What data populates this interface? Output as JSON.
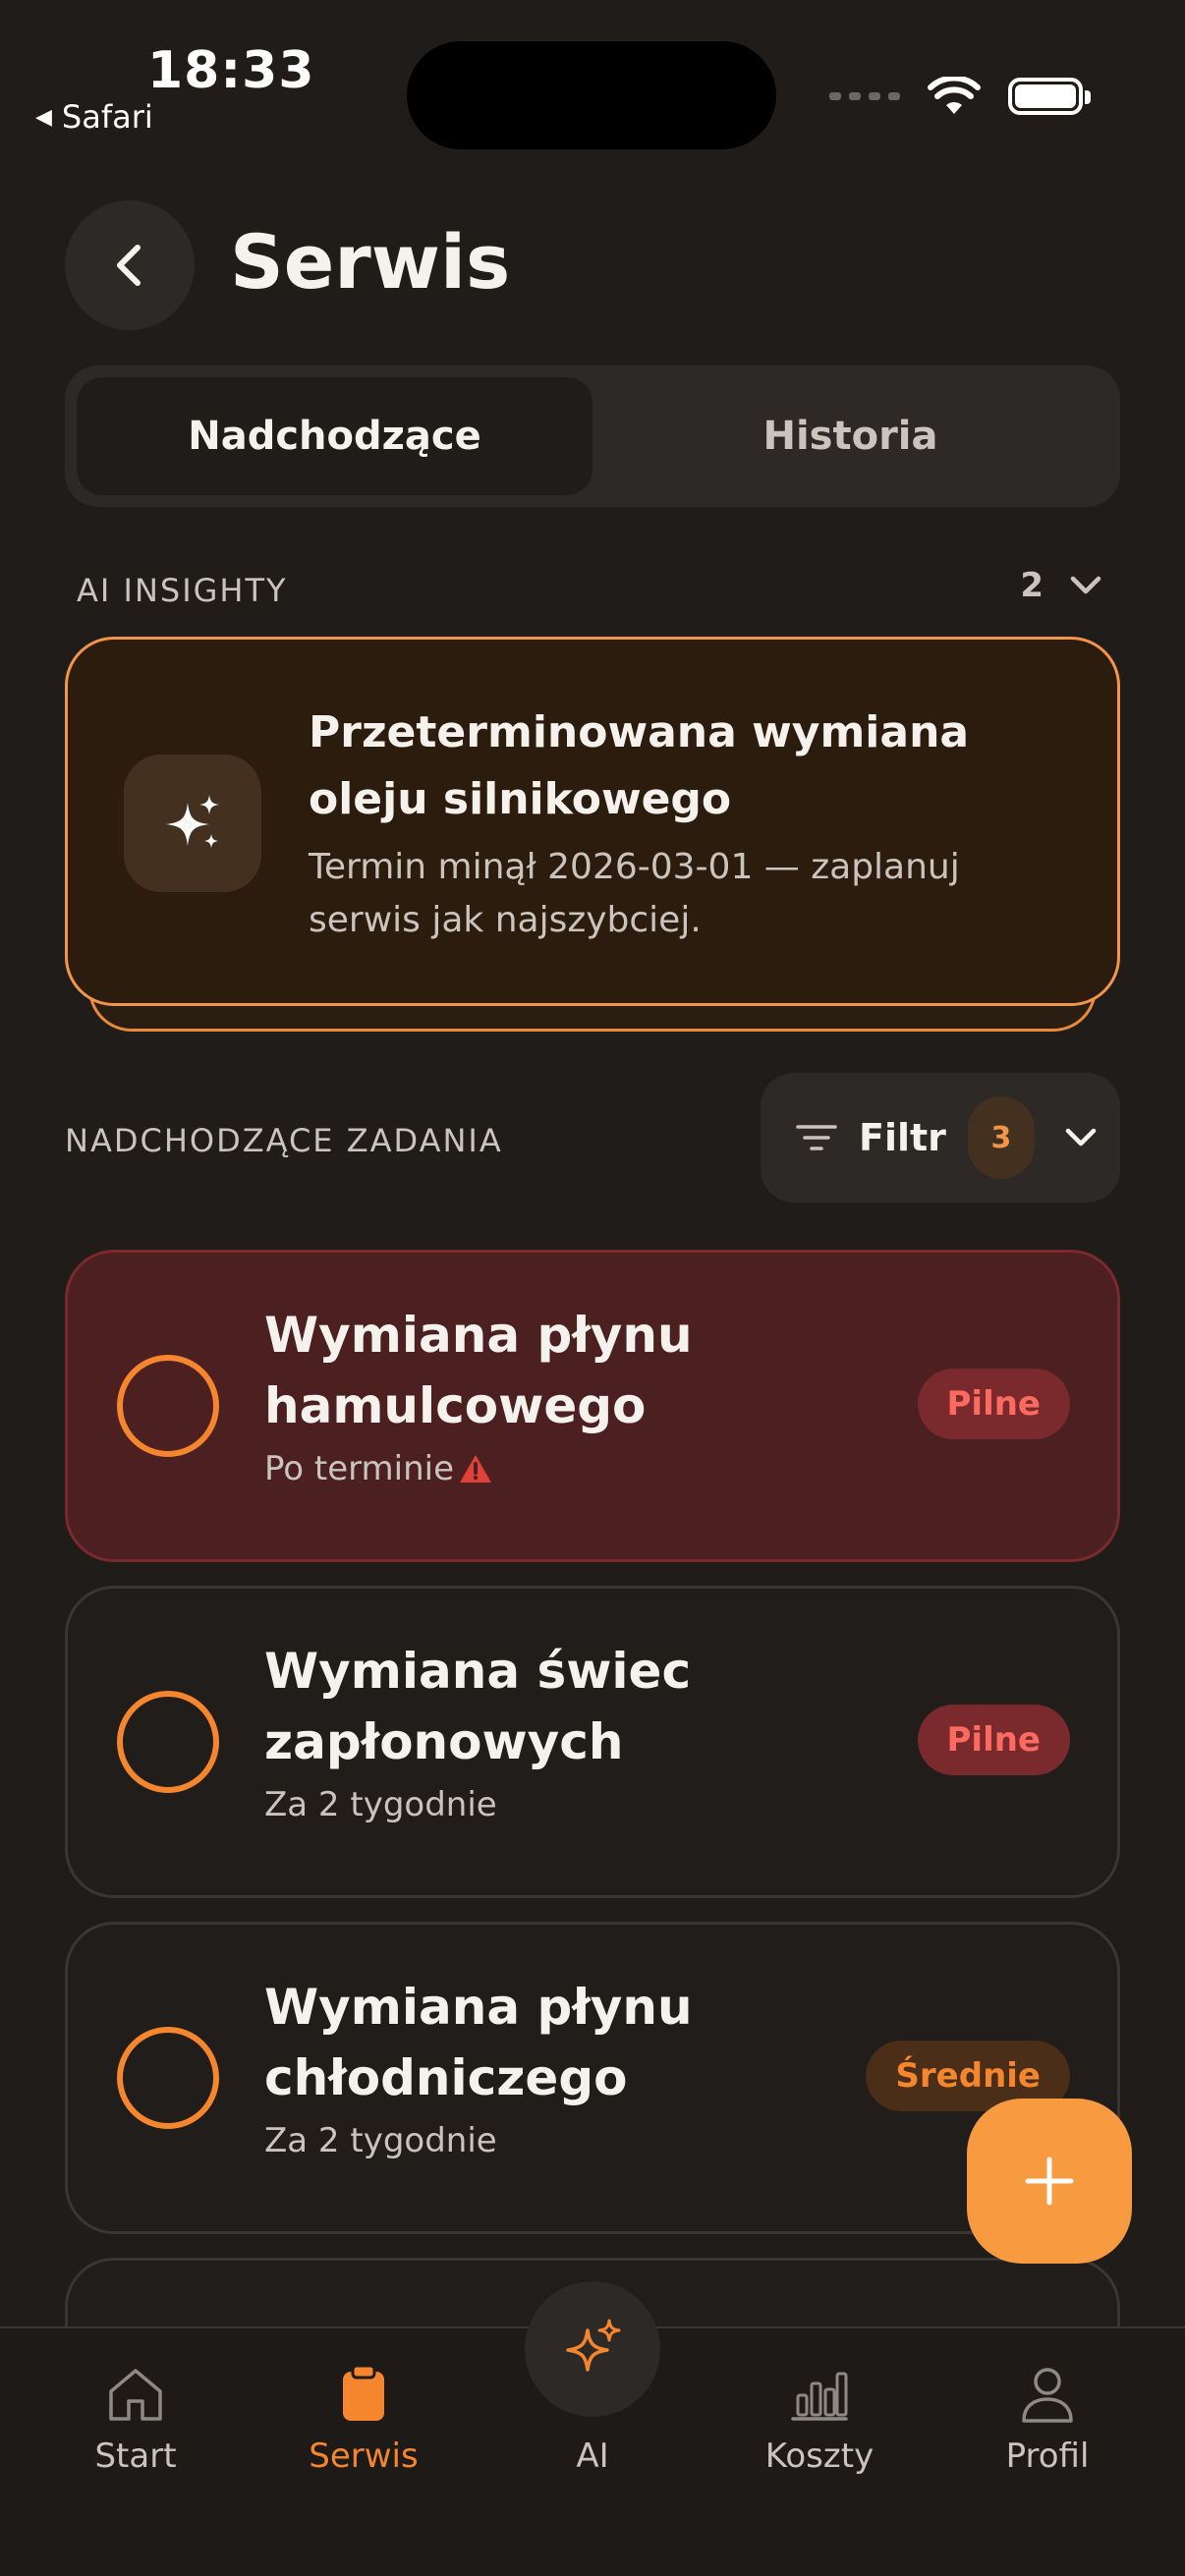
{
  "status_bar": {
    "time": "18:33",
    "back_app": "Safari"
  },
  "header": {
    "title": "Serwis"
  },
  "segmented": {
    "tabs": [
      "Nadchodzące",
      "Historia"
    ],
    "active": 0
  },
  "ai_insights": {
    "label": "AI INSIGHTY",
    "count": "2",
    "card": {
      "title": "Przeterminowana wymiana oleju silnikowego",
      "description": "Termin minął 2026-03-01 — zaplanuj serwis jak najszybciej."
    }
  },
  "tasks_section": {
    "label": "NADCHODZĄCE ZADANIA",
    "filter_label": "Filtr",
    "filter_count": "3"
  },
  "tasks": [
    {
      "title": "Wymiana płynu hamulcowego",
      "subtitle": "Po terminie",
      "badge": "Pilne",
      "urgent": true
    },
    {
      "title": "Wymiana świec zapłonowych",
      "subtitle": "Za 2 tygodnie",
      "badge": "Pilne",
      "urgent": false
    },
    {
      "title": "Wymiana płynu chłodniczego",
      "subtitle": "Za 2 tygodnie",
      "badge": "Średnie",
      "urgent": false
    }
  ],
  "tab_bar": {
    "items": [
      "Start",
      "Serwis",
      "AI",
      "Koszty",
      "Profil"
    ],
    "active": "Serwis"
  },
  "colors": {
    "accent": "#f5862e",
    "background": "#1f1c1a",
    "urgent_bg": "#4c1f21",
    "badge_red_text": "#ff6a60"
  }
}
